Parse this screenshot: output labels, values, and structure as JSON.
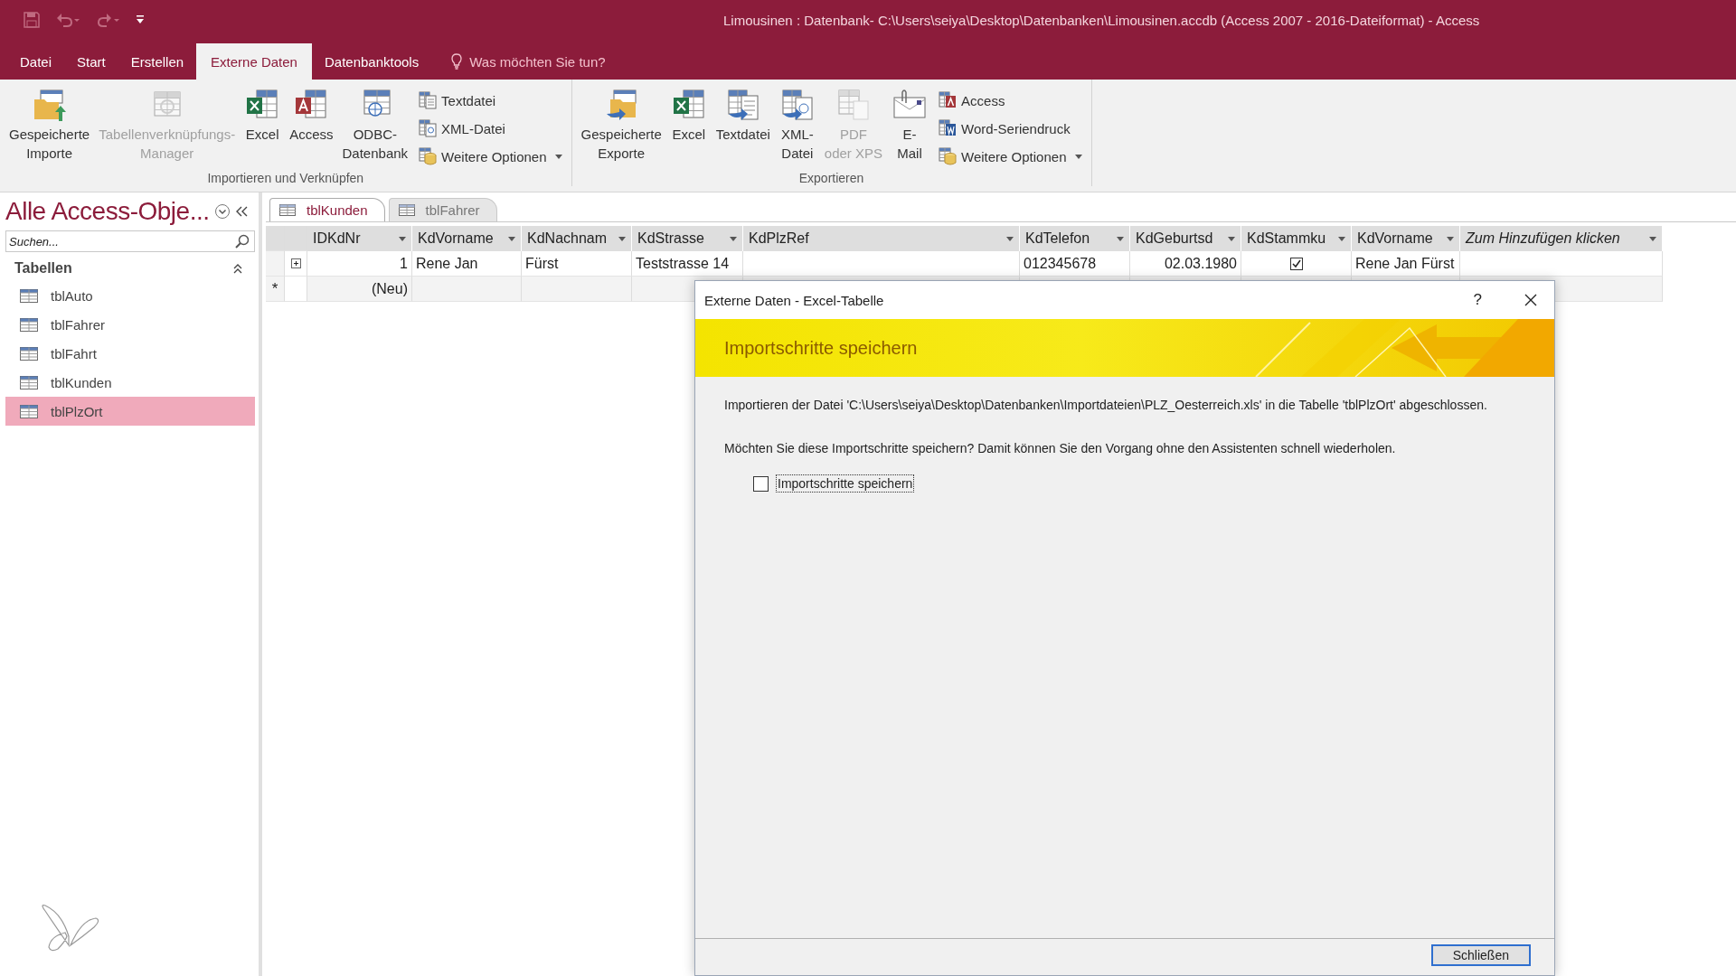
{
  "window": {
    "title": "Limousinen : Datenbank- C:\\Users\\seiya\\Desktop\\Datenbanken\\Limousinen.accdb (Access 2007 - 2016-Dateiformat)  -  Access"
  },
  "ribbon_tabs": [
    {
      "label": "Datei",
      "selected": false
    },
    {
      "label": "Start",
      "selected": false
    },
    {
      "label": "Erstellen",
      "selected": false
    },
    {
      "label": "Externe Daten",
      "selected": true
    },
    {
      "label": "Datenbanktools",
      "selected": false
    }
  ],
  "tell_me": {
    "label": "Was möchten Sie tun?"
  },
  "ribbon_groups": [
    {
      "label": "Importieren und Verknüpfen",
      "large_buttons": [
        {
          "label": "Gespeicherte\nImporte",
          "kind": "saved_import",
          "disabled": false
        },
        {
          "label": "Tabellenverknüpfungs-\nManager",
          "kind": "link_manager",
          "disabled": true
        },
        {
          "label": "Excel",
          "kind": "excel",
          "disabled": false
        },
        {
          "label": "Access",
          "kind": "access",
          "disabled": false
        },
        {
          "label": "ODBC-\nDatenbank",
          "kind": "odbc",
          "disabled": false
        }
      ],
      "small_buttons": [
        {
          "label": "Textdatei",
          "kind": "text",
          "dropdown": false
        },
        {
          "label": "XML-Datei",
          "kind": "xml",
          "dropdown": false
        },
        {
          "label": "Weitere Optionen",
          "kind": "more",
          "dropdown": true
        }
      ]
    },
    {
      "label": "Exportieren",
      "large_buttons": [
        {
          "label": "Gespeicherte\nExporte",
          "kind": "saved_export",
          "disabled": false
        },
        {
          "label": "Excel",
          "kind": "excel",
          "disabled": false
        },
        {
          "label": "Textdatei",
          "kind": "text",
          "disabled": false
        },
        {
          "label": "XML-\nDatei",
          "kind": "xml",
          "disabled": false
        },
        {
          "label": "PDF\noder XPS",
          "kind": "pdf",
          "disabled": true
        },
        {
          "label": "E-\nMail",
          "kind": "email",
          "disabled": false
        }
      ],
      "small_buttons": [
        {
          "label": "Access",
          "kind": "access",
          "dropdown": false
        },
        {
          "label": "Word-Seriendruck",
          "kind": "word",
          "dropdown": false
        },
        {
          "label": "Weitere Optionen",
          "kind": "more",
          "dropdown": true
        }
      ]
    }
  ],
  "navigation": {
    "title": "Alle Access-Obje...",
    "search": {
      "placeholder": "Suchen..."
    },
    "groups": [
      {
        "label": "Tabellen",
        "expanded": true,
        "items": [
          {
            "label": "tblAuto",
            "selected": false
          },
          {
            "label": "tblFahrer",
            "selected": false
          },
          {
            "label": "tblFahrt",
            "selected": false
          },
          {
            "label": "tblKunden",
            "selected": false
          },
          {
            "label": "tblPlzOrt",
            "selected": true
          }
        ]
      }
    ]
  },
  "document_tabs": [
    {
      "label": "tblKunden",
      "selected": true
    },
    {
      "label": "tblFahrer",
      "selected": false
    }
  ],
  "datasheet": {
    "columns": [
      {
        "label": "IDKdNr",
        "kind": "field"
      },
      {
        "label": "KdVorname",
        "kind": "field"
      },
      {
        "label": "KdNachnam",
        "kind": "field"
      },
      {
        "label": "KdStrasse",
        "kind": "field"
      },
      {
        "label": "KdPlzRef",
        "kind": "field"
      },
      {
        "label": "KdTelefon",
        "kind": "field"
      },
      {
        "label": "KdGeburtsd",
        "kind": "field"
      },
      {
        "label": "KdStammku",
        "kind": "field"
      },
      {
        "label": "KdVorname",
        "kind": "field"
      },
      {
        "label": "Zum Hinzufügen klicken",
        "kind": "add"
      }
    ],
    "rows": [
      {
        "kind": "record",
        "expandable": true,
        "cells": [
          {
            "kind": "number",
            "text": "1"
          },
          {
            "kind": "text",
            "text": "Rene Jan"
          },
          {
            "kind": "text",
            "text": "Fürst"
          },
          {
            "kind": "text",
            "text": "Teststrasse 14"
          },
          {
            "kind": "empty"
          },
          {
            "kind": "text",
            "text": "012345678"
          },
          {
            "kind": "number",
            "text": "02.03.1980"
          },
          {
            "kind": "checkbox",
            "checked": true
          },
          {
            "kind": "text",
            "text": "Rene Jan Fürst"
          },
          {
            "kind": "empty"
          }
        ]
      },
      {
        "kind": "new",
        "selector": "*",
        "expandable": false,
        "cells": [
          {
            "kind": "number",
            "text": "(Neu)"
          }
        ]
      }
    ]
  },
  "dialog": {
    "title": "Externe Daten - Excel-Tabelle",
    "help": "?",
    "heading": "Importschritte speichern",
    "message": "Importieren der Datei 'C:\\Users\\seiya\\Desktop\\Datenbanken\\Importdateien\\PLZ_Oesterreich.xls' in die Tabelle 'tblPlzOrt' abgeschlossen.",
    "question": "Möchten Sie diese Importschritte speichern? Damit können Sie den Vorgang ohne den Assistenten schnell wiederholen.",
    "save_option": {
      "label": "Importschritte speichern",
      "checked": false
    },
    "buttons": [
      "Schließen"
    ]
  }
}
